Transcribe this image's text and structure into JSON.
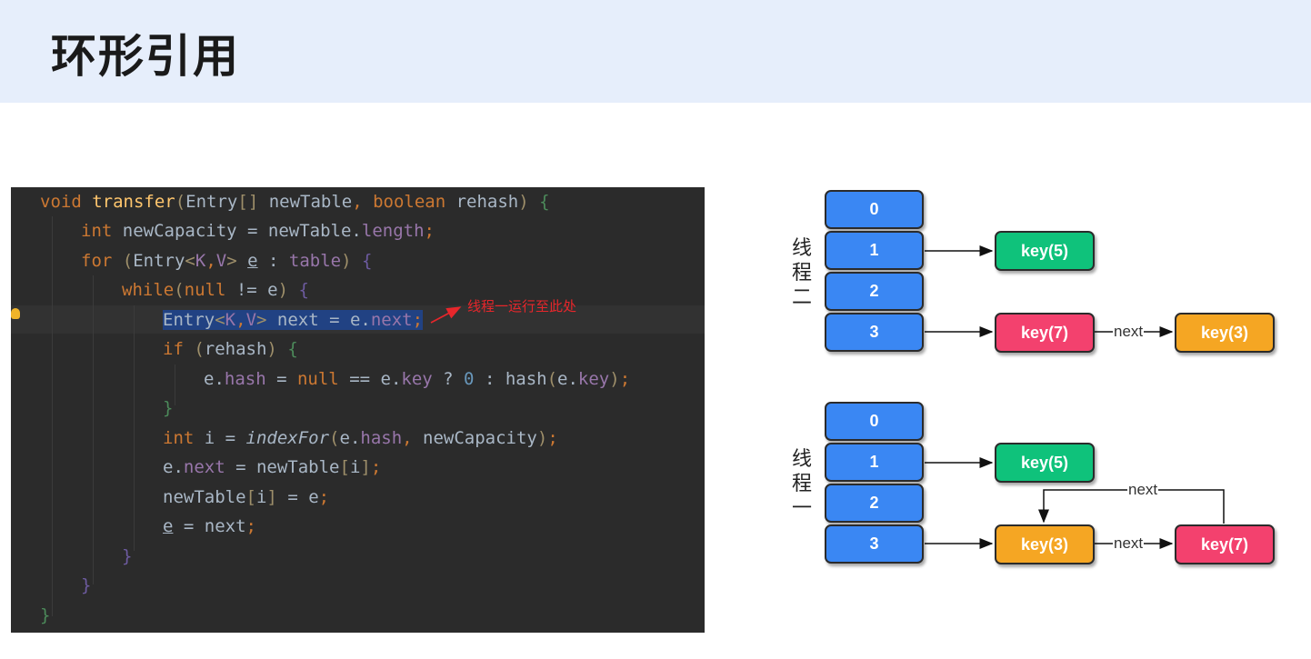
{
  "title": "环形引用",
  "annotation": "线程一运行至此处",
  "diagram": {
    "colors": {
      "bucket": "#3a87f3",
      "green": "#0fc27b",
      "pink": "#f3416e",
      "orange": "#f5a623"
    },
    "top": {
      "label_chars": [
        "线",
        "程",
        "二"
      ],
      "buckets": [
        "0",
        "1",
        "2",
        "3"
      ],
      "node_key5": "key(5)",
      "node_key7": "key(7)",
      "node_key3": "key(3)",
      "next_label": "next"
    },
    "bottom": {
      "label_chars": [
        "线",
        "程",
        "一"
      ],
      "buckets": [
        "0",
        "1",
        "2",
        "3"
      ],
      "node_key5": "key(5)",
      "node_key3": "key(3)",
      "node_key7": "key(7)",
      "next_label_forward": "next",
      "next_label_back": "next"
    }
  }
}
